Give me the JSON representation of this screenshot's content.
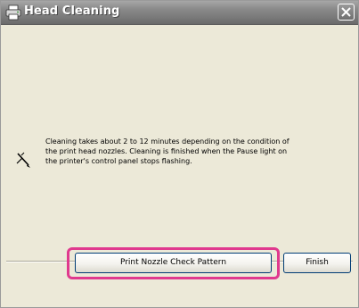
{
  "window": {
    "title": "Head Cleaning",
    "title_icon": "printer-icon",
    "close_icon": "close-icon"
  },
  "message": {
    "icon": "pen-icon",
    "text": "Cleaning takes about 2 to 12 minutes depending on the condition of\nthe print head nozzles. Cleaning is finished when the Pause light on\nthe printer's control panel stops flashing."
  },
  "buttons": {
    "nozzle_check_label": "Print Nozzle Check Pattern",
    "finish_label": "Finish"
  },
  "colors": {
    "highlight": "#e0398e",
    "title_bar": "#8a8a8a",
    "dialog_bg": "#ece9d8"
  }
}
